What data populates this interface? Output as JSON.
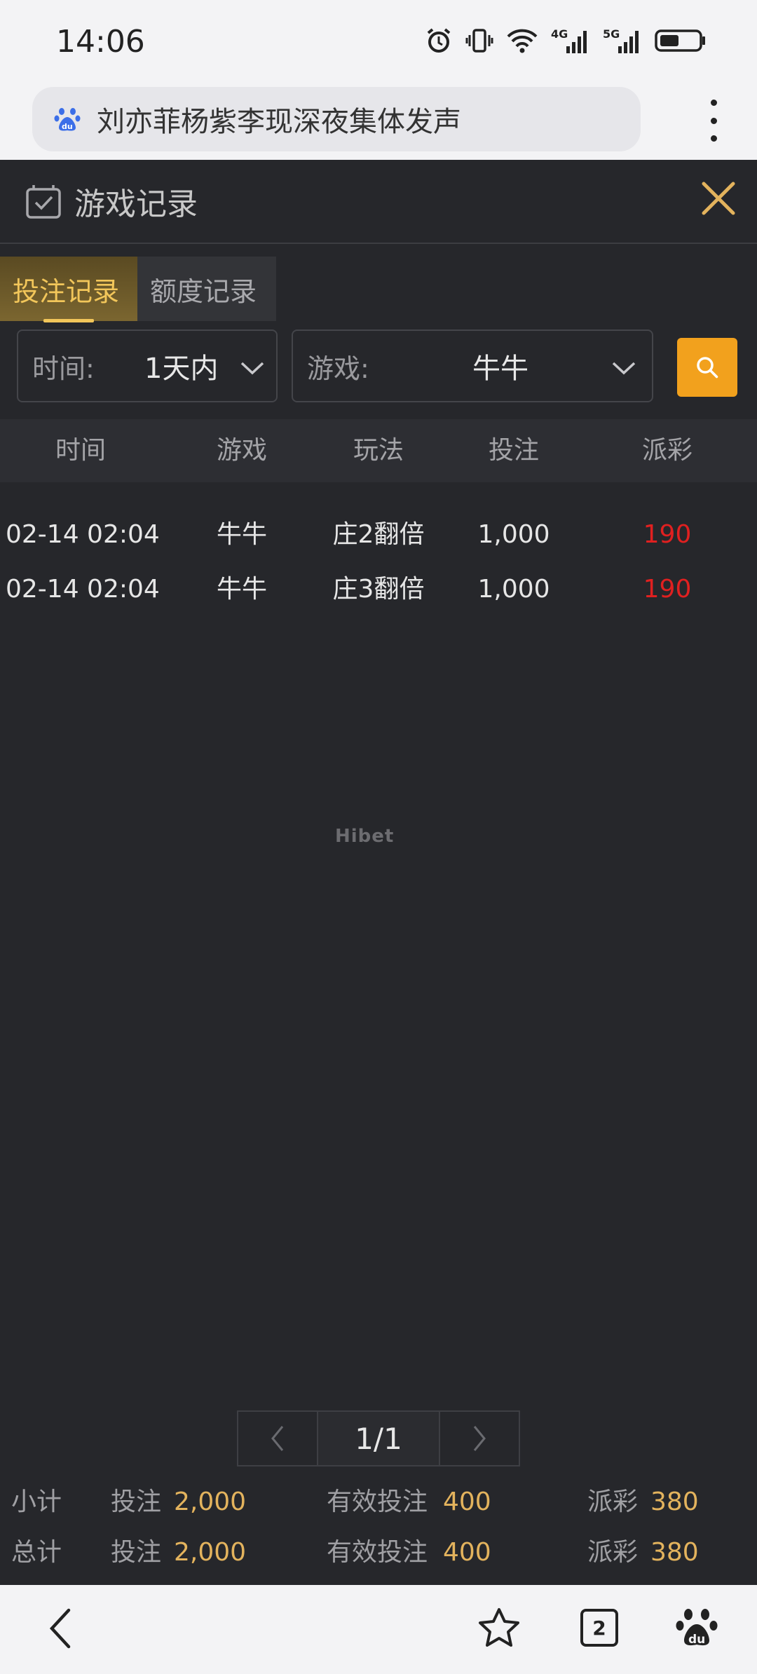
{
  "status_bar": {
    "time": "14:06"
  },
  "browser": {
    "search_text": "刘亦菲杨紫李现深夜集体发声",
    "tab_count": "2"
  },
  "app": {
    "title": "游戏记录",
    "tabs": [
      {
        "label": "投注记录",
        "active": true
      },
      {
        "label": "额度记录",
        "active": false
      }
    ],
    "filters": {
      "time_label": "时间:",
      "time_value": "1天内",
      "game_label": "游戏:",
      "game_value": "牛牛"
    },
    "table": {
      "headers": [
        "时间",
        "游戏",
        "玩法",
        "投注",
        "派彩"
      ],
      "rows": [
        {
          "time": "02-14 02:04",
          "game": "牛牛",
          "play": "庄2翻倍",
          "bet": "1,000",
          "payout": "190"
        },
        {
          "time": "02-14 02:04",
          "game": "牛牛",
          "play": "庄3翻倍",
          "bet": "1,000",
          "payout": "190"
        }
      ]
    },
    "watermark": "Hibet",
    "pagination": {
      "label": "1/1"
    },
    "summary": {
      "subtotal": {
        "label": "小计",
        "bet_label": "投注",
        "bet": "2,000",
        "valid_label": "有效投注",
        "valid": "400",
        "payout_label": "派彩",
        "payout": "380"
      },
      "total": {
        "label": "总计",
        "bet_label": "投注",
        "bet": "2,000",
        "valid_label": "有效投注",
        "valid": "400",
        "payout_label": "派彩",
        "payout": "380"
      }
    }
  },
  "colors": {
    "accent": "#f2a11d",
    "highlight": "#e3b35d",
    "payout": "#e02020",
    "background": "#26272b"
  },
  "icons": [
    "alarm-icon",
    "vibrate-icon",
    "wifi-icon",
    "signal-4g-icon",
    "signal-5g-icon",
    "battery-icon",
    "baidu-icon",
    "more-icon",
    "record-icon",
    "close-icon",
    "chevron-down-icon",
    "search-icon",
    "chevron-left-icon",
    "chevron-right-icon",
    "back-icon",
    "star-icon",
    "tabs-icon",
    "baidu-paw-icon"
  ]
}
